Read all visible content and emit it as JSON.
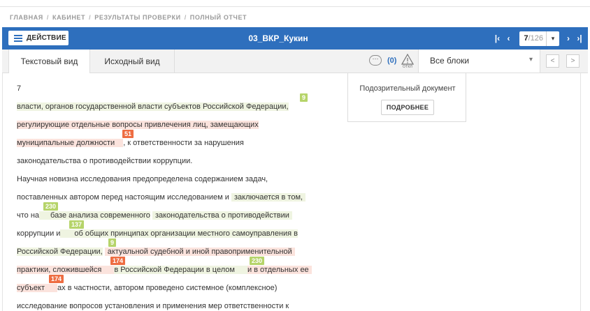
{
  "breadcrumb": [
    "ГЛАВНАЯ",
    "КАБИНЕТ",
    "РЕЗУЛЬТАТЫ ПРОВЕРКИ",
    "ПОЛНЫЙ ОТЧЕТ"
  ],
  "toolbar": {
    "action_label": "ДЕЙСТВИЕ",
    "doc_title": "03_ВКР_Кукин",
    "first_icon": "⏮",
    "prev_icon": "‹",
    "next_icon": "›",
    "last_icon": "⏭",
    "page_current": "7",
    "page_total": "/126",
    "page_dropdown": "⌄"
  },
  "tabs": [
    {
      "label": "Текстовый вид",
      "active": true
    },
    {
      "label": "Исходный вид",
      "active": false
    }
  ],
  "tabs_bar": {
    "comment_icon": "···",
    "comment_count": "(0)",
    "warning_label": "ОТКЛ",
    "blocks_select": "Все блоки",
    "blocks_chevron": "⌄",
    "prev_block": "<",
    "next_block": ">"
  },
  "popup": {
    "title": "Подозрительный документ",
    "button": "ПОДРОБНЕЕ"
  },
  "text_lines": [
    "7",
    "власти, органов государственной власти субъектов Российской Федерации,",
    "регулирующие отдельные вопросы привлечения лиц, замещающих",
    "муниципальные должности",
    ", к ответственности за нарушения",
    "законодательства о противодействии коррупции.",
    "Научная новизна исследования предопределена содержанием задач,",
    "поставленных автором перед настоящим исследованием и",
    "заключается в том,",
    "что на",
    "базе анализа современного",
    "законодательства о противодействии",
    "коррупции и",
    "об общих принципах организации местного самоуправления в",
    "Российской Федерации,",
    "актуальной судебной и иной правоприменительной",
    "практики, сложившейся",
    "в Российской Федерации в целом",
    "и в отдельных ее",
    "субъект",
    "ах в частности, автором проведено системное (комплексное)",
    "исследование вопросов установления и применения мер ответственности к"
  ],
  "badges": [
    "9",
    "51",
    "230",
    "137",
    "9",
    "174",
    "230",
    "174"
  ],
  "colors": {
    "toolbar_blue": "#2e6fbd",
    "highlight_red": "#fbe3dd",
    "highlight_green": "#eff4e1",
    "badge_green": "#b6d46a",
    "badge_orange": "#ee6d42"
  }
}
